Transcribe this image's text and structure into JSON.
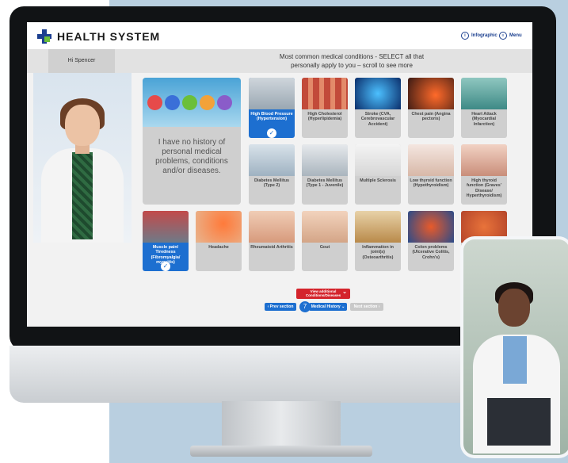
{
  "app": {
    "brand": "HEALTH SYSTEM",
    "infographic_label": "Infographic",
    "menu_label": "Menu",
    "greeting": "Hi Spencer",
    "instructions_line1": "Most common medical conditions - SELECT all that",
    "instructions_line2": "personally apply to you – scroll to see more"
  },
  "feature_card": {
    "text": "I have no history of personal medical problems, conditions and/or diseases."
  },
  "conditions": [
    {
      "label": "High Blood Pressure (Hypertension)",
      "selected": true
    },
    {
      "label": "High Cholesterol (Hyperlipidemia)",
      "selected": false
    },
    {
      "label": "Stroke (CVA, Cerebrovascular Accident)",
      "selected": false
    },
    {
      "label": "Chest pain (Angina pectoris)",
      "selected": false
    },
    {
      "label": "Heart Attack (Myocardial Infarction)",
      "selected": false
    },
    {
      "label": "Diabetes Mellitus (Type 2)",
      "selected": false
    },
    {
      "label": "Diabetes Mellitus (Type 1 - Juvenile)",
      "selected": false
    },
    {
      "label": "Multiple Sclerosis",
      "selected": false
    },
    {
      "label": "Low thyroid function (Hypothyroidism)",
      "selected": false
    },
    {
      "label": "High thyroid function (Graves' Disease/ Hyperthyroidism)",
      "selected": false
    },
    {
      "label": "Muscle pain/ Tiredness (Fibromyalgia/ myositis)",
      "selected": true
    },
    {
      "label": "Headache",
      "selected": false
    },
    {
      "label": "Rheumatoid Arthritis",
      "selected": false
    },
    {
      "label": "Gout",
      "selected": false
    },
    {
      "label": "Inflammation in joint(s) (Osteoarthritis)",
      "selected": false
    },
    {
      "label": "Colon problems (Ulcerative Colitis, Crohn's)",
      "selected": false
    }
  ],
  "buttons": {
    "view_more": "View additional Conditions/Diseases",
    "prev": "Prev section",
    "section_number": "7",
    "section": "Medical History",
    "next": "Next section"
  },
  "colors": {
    "accent_blue": "#1d6fd0",
    "alert_red": "#d4242c"
  }
}
